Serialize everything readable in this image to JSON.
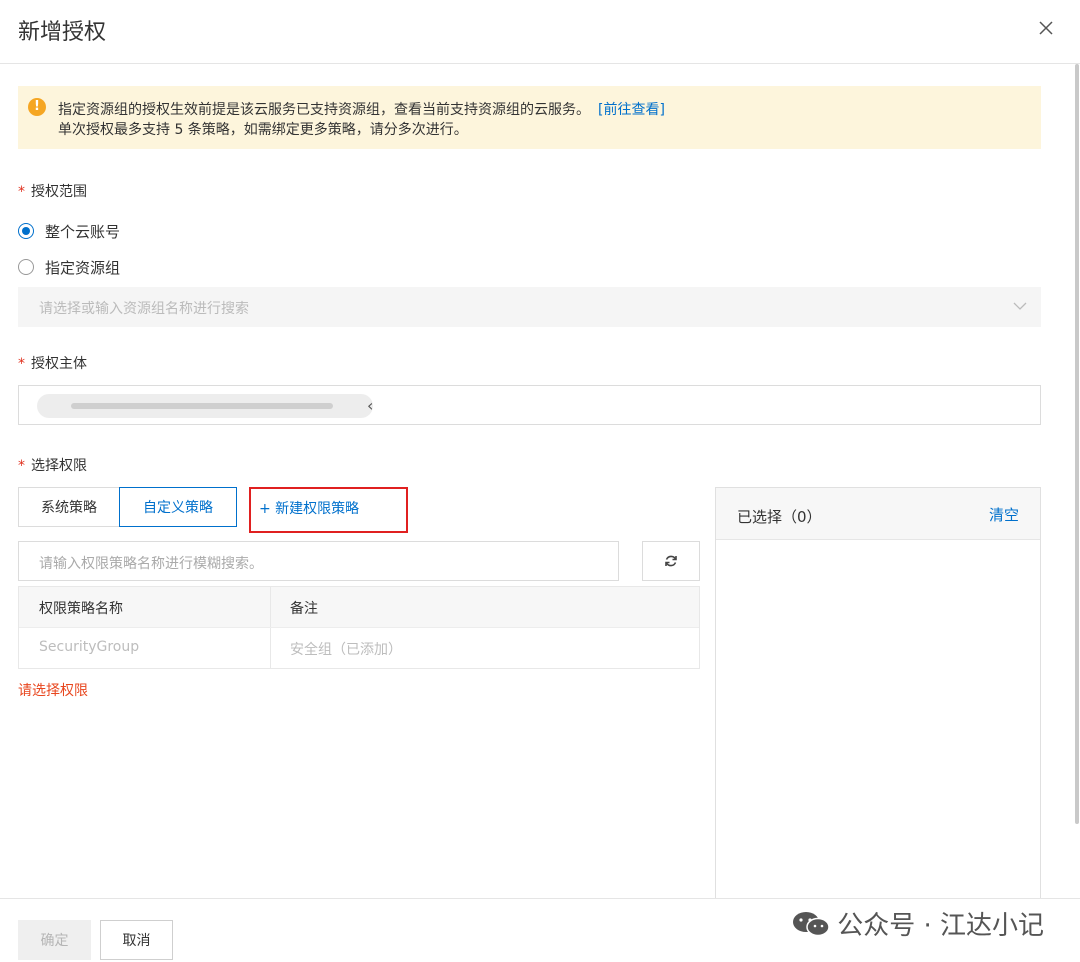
{
  "dialog": {
    "title": "新增授权"
  },
  "alert": {
    "line1": "指定资源组的授权生效前提是该云服务已支持资源组，查看当前支持资源组的云服务。",
    "link": "[前往查看]",
    "line2": "单次授权最多支持 5 条策略，如需绑定更多策略，请分多次进行。"
  },
  "scope": {
    "label": "授权范围",
    "options": [
      {
        "label": "整个云账号",
        "checked": true
      },
      {
        "label": "指定资源组",
        "checked": false
      }
    ],
    "resource_group_placeholder": "请选择或输入资源组名称进行搜索"
  },
  "subject": {
    "label": "授权主体"
  },
  "permissions": {
    "label": "选择权限",
    "tabs": [
      {
        "label": "系统策略",
        "active": false
      },
      {
        "label": "自定义策略",
        "active": true
      }
    ],
    "new_policy_label": "+ 新建权限策略",
    "search_placeholder": "请输入权限策略名称进行模糊搜索。",
    "table": {
      "columns": [
        "权限策略名称",
        "备注"
      ],
      "rows": [
        {
          "name": "SecurityGroup",
          "note": "安全组（已添加）",
          "disabled": true
        }
      ]
    },
    "error": "请选择权限"
  },
  "selected": {
    "title": "已选择（0）",
    "clear_label": "清空"
  },
  "footer": {
    "ok_label": "确定",
    "cancel_label": "取消"
  },
  "watermark": {
    "text": "公众号 · 江达小记"
  },
  "colors": {
    "accent": "#0070cc",
    "error": "#e8461e",
    "warning": "#f5a623",
    "highlight_border": "#e02020"
  }
}
